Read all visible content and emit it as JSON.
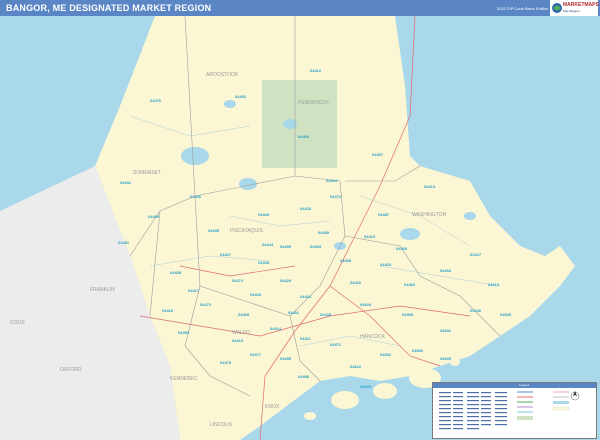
{
  "header": {
    "title": "BANGOR, ME DESIGNATED MARKET REGION",
    "edition": "2023 ZIP Code Basic Edition",
    "logo_text": "MARKETMAPS",
    "logo_sub": "Map Mapper"
  },
  "colors": {
    "ocean": "#a8d8ea",
    "land_region": "#fbf6d3",
    "land_outside": "#ececec",
    "park": "#cfe3c2",
    "zip_label": "#29a0c8",
    "header": "#5a86c5"
  },
  "map": {
    "county_labels": [
      "AROOSTOOK",
      "PENOBSCOT",
      "SOMERSET",
      "PISCATAQUIS",
      "WASHINGTON",
      "HANCOCK",
      "WALDO",
      "FRANKLIN",
      "OXFORD",
      "KENNEBEC",
      "KNOX",
      "LINCOLN",
      "COOS"
    ],
    "zip_labels": [
      "04476",
      "04462",
      "04460",
      "04497",
      "04413",
      "04412",
      "04441",
      "04456",
      "04490",
      "04481",
      "04418",
      "04449",
      "04487",
      "04445",
      "04424",
      "04459",
      "04453",
      "04428",
      "04429",
      "04474",
      "04433",
      "04401",
      "04473",
      "04410",
      "04408",
      "04419",
      "04420",
      "04423",
      "04438",
      "04427",
      "04434",
      "04435",
      "04417",
      "04414",
      "04415",
      "04477",
      "04475",
      "04411",
      "04471",
      "04495",
      "04463",
      "04454",
      "04427",
      "04613",
      "04640",
      "04631",
      "04660",
      "04652",
      "04605",
      "04634",
      "04472",
      "04468",
      "04489",
      "04455",
      "04496",
      "04622",
      "04605",
      "04444",
      "04450",
      "04469",
      "04625"
    ]
  },
  "legend": {
    "title": "Legend"
  }
}
